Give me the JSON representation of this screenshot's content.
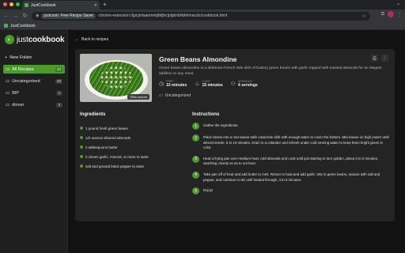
{
  "browser": {
    "tab_title": "JustCookbook",
    "new_tab": "+",
    "omnibox_chip": "justcook: Free Recipe Saver",
    "url": "chrome-extension://jpcjmlaanmmjdldjhclplgknbhbfehnecdc/cookbook.html",
    "bookmark_label": "JustCookbook"
  },
  "sidebar": {
    "logo_prefix": "just",
    "logo_suffix": "cookbook",
    "new_folder": "New Folder",
    "folders": [
      {
        "label": "All Recipes",
        "count": "43",
        "active": true
      },
      {
        "label": "Uncategorized",
        "count": "40",
        "active": false
      },
      {
        "label": "BIP",
        "count": "1",
        "active": false
      },
      {
        "label": "dinner",
        "count": "2",
        "active": false
      }
    ]
  },
  "main": {
    "back_label": "Back to recipes",
    "recipe": {
      "title": "Green Beans Almondine",
      "description": "Green beans almondine is a delicious French side dish of buttery green beans with garlic topped with toasted almonds for an elegant addition to any meal.",
      "view_source": "View source",
      "stats": [
        {
          "icon": "clock-icon",
          "label": "Prep",
          "value": "10 minutes"
        },
        {
          "icon": "flame-icon",
          "label": "Cook",
          "value": "15 minutes"
        },
        {
          "icon": "people-icon",
          "label": "Servings",
          "value": "4 servings"
        }
      ],
      "folder": "Uncategorized",
      "ingredients_heading": "Ingredients",
      "ingredients": [
        "1 pound fresh green beans",
        "1/2 ounces slivered almonds",
        "2 tablespoons butter",
        "2 cloves garlic, minced, or more to taste",
        "salt and ground black pepper to taste"
      ],
      "instructions_heading": "Instructions",
      "instructions": [
        {
          "n": "1",
          "text": "Gather the ingredients."
        },
        {
          "n": "2",
          "text": "Place beans into a microwave-safe casserole dish with enough water to cover the bottom. Microwave on high power until almost tender, 5 to 10 minutes. Drain in a colander and refresh under cold running water to keep them bright green in color."
        },
        {
          "n": "3",
          "text": "Heat a frying pan over medium heat. Add almonds and cook until just starting to turn golden, about 3 to 5 minutes, watching closely so as to not burn."
        },
        {
          "n": "4",
          "text": "Take pan off of heat and add butter to melt. Return to heat and add garlic. Mix in green beans, season with salt and pepper, and continue to stir until heated through, 3 to 5 minutes."
        },
        {
          "n": "5",
          "text": "Enjoy!"
        }
      ]
    }
  },
  "colors": {
    "accent": "#4c9a2a",
    "background": "#121212",
    "card": "#242424"
  }
}
